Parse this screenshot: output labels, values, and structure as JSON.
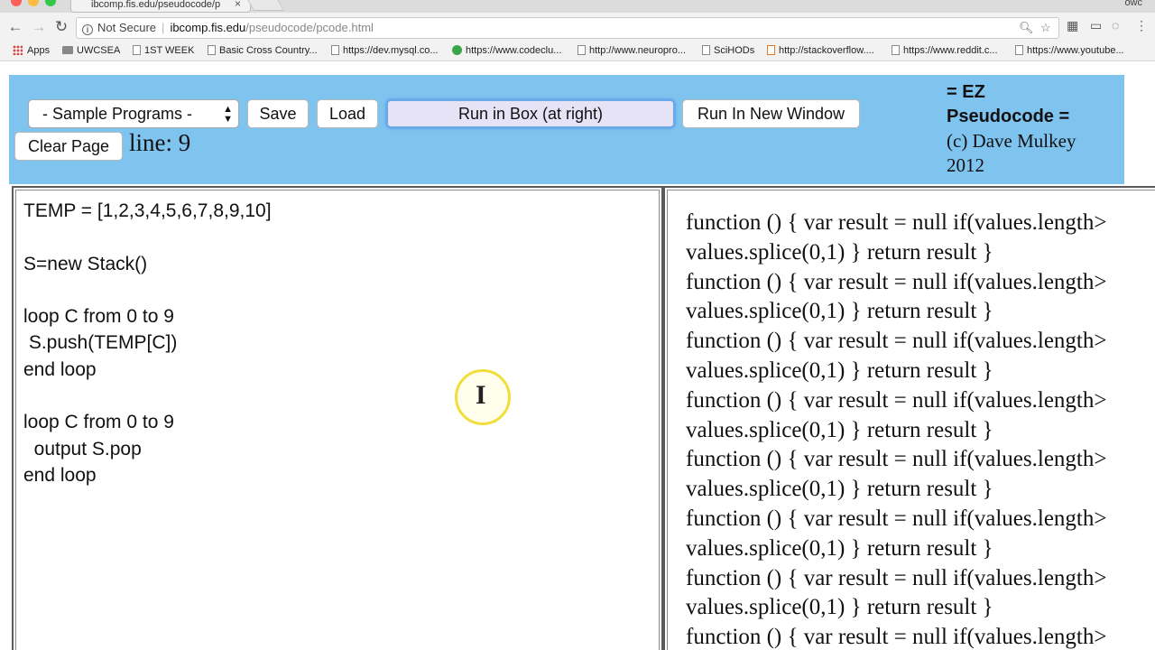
{
  "browser": {
    "tab_title": "ibcomp.fis.edu/pseudocode/p",
    "tab_close": "×",
    "profile_label": "owc",
    "url_security": "Not Secure",
    "url_host": "ibcomp.fis.edu",
    "url_path": "/pseudocode/pcode.html",
    "bookmarks": [
      {
        "label": "Apps",
        "icon": "apps-grid-icon"
      },
      {
        "label": "UWCSEA",
        "icon": "folder-icon"
      },
      {
        "label": "1ST WEEK",
        "icon": "page-icon"
      },
      {
        "label": "Basic Cross Country...",
        "icon": "page-icon"
      },
      {
        "label": "https://dev.mysql.co...",
        "icon": "page-icon"
      },
      {
        "label": "https://www.codeclu...",
        "icon": "codeclub-icon"
      },
      {
        "label": "http://www.neuropro...",
        "icon": "page-icon"
      },
      {
        "label": "SciHODs",
        "icon": "page-icon"
      },
      {
        "label": "http://stackoverflow....",
        "icon": "stackoverflow-icon"
      },
      {
        "label": "https://www.reddit.c...",
        "icon": "page-icon"
      },
      {
        "label": "https://www.youtube...",
        "icon": "page-icon"
      }
    ]
  },
  "header": {
    "sample_programs": "- Sample Programs -",
    "save": "Save",
    "load": "Load",
    "run_in_box": "Run in Box (at right)",
    "run_new_window": "Run In New Window",
    "clear_page": "Clear Page",
    "line_label": "line: 9",
    "title_line1": "= EZ",
    "title_line2": "Pseudocode =",
    "credit_line1": "(c) Dave Mulkey",
    "credit_line2": "2012"
  },
  "code": "TEMP = [1,2,3,4,5,6,7,8,9,10]\n\nS=new Stack()\n\nloop C from 0 to 9\n S.push(TEMP[C])\nend loop\n\nloop C from 0 to 9\n  output S.pop\nend loop",
  "output_lines": [
    "function () { var result = null if(values.length>",
    "values.splice(0,1) } return result }",
    "function () { var result = null if(values.length>",
    "values.splice(0,1) } return result }",
    "function () { var result = null if(values.length>",
    "values.splice(0,1) } return result }",
    "function () { var result = null if(values.length>",
    "values.splice(0,1) } return result }",
    "function () { var result = null if(values.length>",
    "values.splice(0,1) } return result }",
    "function () { var result = null if(values.length>",
    "values.splice(0,1) } return result }",
    "function () { var result = null if(values.length>",
    "values.splice(0,1) } return result }",
    "function () { var result = null if(values.length>"
  ],
  "colors": {
    "header_bg": "#7fc3ef",
    "primary_button_bg": "#e6e3f7",
    "cursor_highlight": "#f2de3a"
  }
}
